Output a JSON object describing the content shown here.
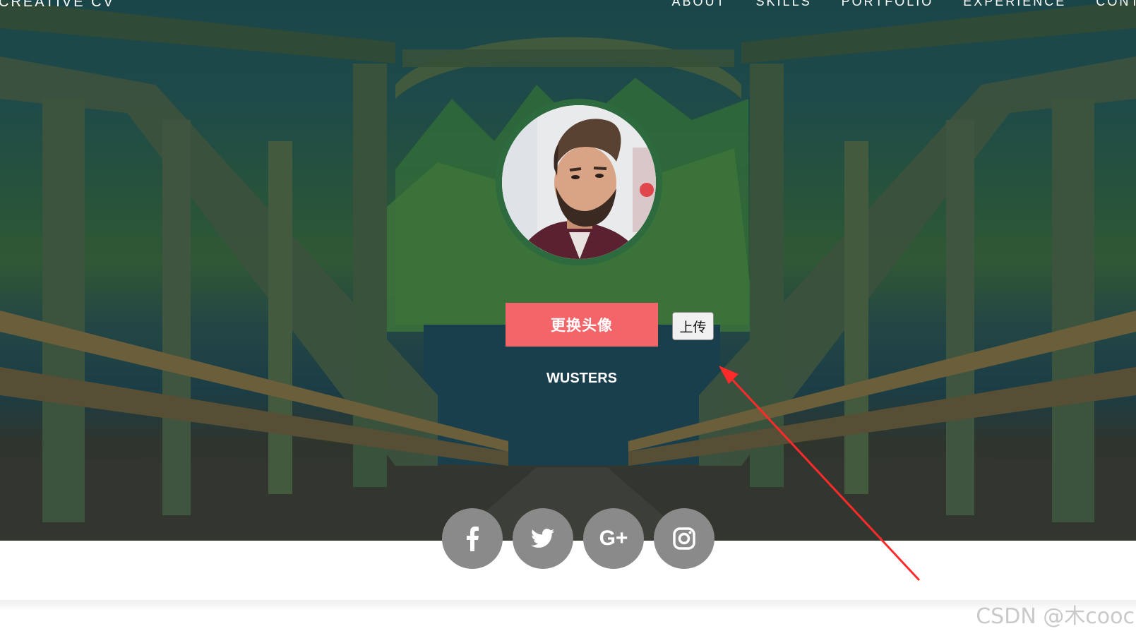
{
  "header": {
    "brand": "CREATIVE CV",
    "nav": [
      "ABOUT",
      "SKILLS",
      "PORTFOLIO",
      "EXPERIENCE",
      "CONTA"
    ]
  },
  "profile": {
    "change_avatar_label": "更换头像",
    "upload_label": "上传",
    "name": "WUSTERS"
  },
  "social": {
    "icons": [
      "facebook-icon",
      "twitter-icon",
      "google-plus-icon",
      "instagram-icon"
    ],
    "gplus_text": "G+"
  },
  "watermark": "CSDN @木cooc",
  "colors": {
    "accent_button": "#f4656a",
    "avatar_ring": "#2d6a3e",
    "social_bg": "#8a8a8a",
    "annotation_arrow": "#ff2a2a"
  }
}
